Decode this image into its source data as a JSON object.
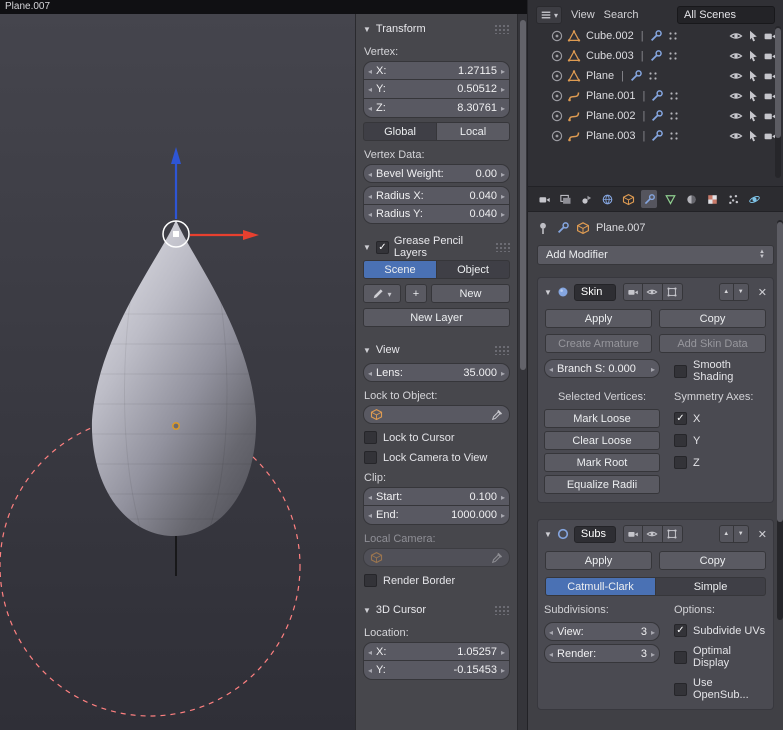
{
  "window": {
    "title": "Plane.007"
  },
  "colors": {
    "accent_blue": "#4a71b4",
    "object_orange": "#de9b52",
    "lamp_red": "#ff8080"
  },
  "outliner": {
    "view_menu": "View",
    "search_menu": "Search",
    "scenes_filter": "All Scenes",
    "items": [
      {
        "name": "Cube.002"
      },
      {
        "name": "Cube.003"
      },
      {
        "name": "Plane"
      },
      {
        "name": "Plane.001"
      },
      {
        "name": "Plane.002"
      },
      {
        "name": "Plane.003"
      }
    ]
  },
  "npanel": {
    "transform": {
      "title": "Transform",
      "vertex_label": "Vertex:",
      "x_label": "X:",
      "x_value": "1.27115",
      "y_label": "Y:",
      "y_value": "0.50512",
      "z_label": "Z:",
      "z_value": "8.30761",
      "global_button": "Global",
      "local_button": "Local",
      "vertex_data_label": "Vertex Data:",
      "bevel_label": "Bevel Weight:",
      "bevel_value": "0.00",
      "radius_x_label": "Radius X:",
      "radius_x_value": "0.040",
      "radius_y_label": "Radius Y:",
      "radius_y_value": "0.040"
    },
    "grease": {
      "title": "Grease Pencil Layers",
      "scene_tab": "Scene",
      "object_tab": "Object",
      "new_button": "New",
      "new_layer_button": "New Layer"
    },
    "view": {
      "title": "View",
      "lens_label": "Lens:",
      "lens_value": "35.000",
      "lock_to_object_label": "Lock to Object:",
      "lock_to_cursor": "Lock to Cursor",
      "lock_camera_to_view": "Lock Camera to View",
      "clip_label": "Clip:",
      "start_label": "Start:",
      "start_value": "0.100",
      "end_label": "End:",
      "end_value": "1000.000",
      "local_camera_label": "Local Camera:",
      "render_border": "Render Border"
    },
    "cursor": {
      "title": "3D Cursor",
      "location_label": "Location:",
      "x_label": "X:",
      "x_value": "1.05257",
      "y_label": "Y:",
      "y_value": "-0.15453"
    }
  },
  "properties": {
    "breadcrumb": "Plane.007",
    "add_modifier": "Add Modifier",
    "skin": {
      "name": "Skin",
      "apply": "Apply",
      "copy": "Copy",
      "create_armature": "Create Armature",
      "add_skin_data": "Add Skin Data",
      "branch_smoothing": "Branch S: 0.000",
      "smooth_shading": "Smooth Shading",
      "selected_vertices_label": "Selected Vertices:",
      "symmetry_axes_label": "Symmetry Axes:",
      "mark_loose": "Mark Loose",
      "clear_loose": "Clear Loose",
      "mark_root": "Mark Root",
      "equalize_radii": "Equalize Radii",
      "axis_x": "X",
      "axis_y": "Y",
      "axis_z": "Z"
    },
    "subsurf": {
      "name": "Subs",
      "apply": "Apply",
      "copy": "Copy",
      "catmull_clark": "Catmull-Clark",
      "simple": "Simple",
      "subdivisions_label": "Subdivisions:",
      "options_label": "Options:",
      "view_label": "View:",
      "view_value": "3",
      "render_label": "Render:",
      "render_value": "3",
      "subdivide_uvs": "Subdivide UVs",
      "optimal_display": "Optimal Display",
      "use_opensub": "Use OpenSub..."
    }
  }
}
